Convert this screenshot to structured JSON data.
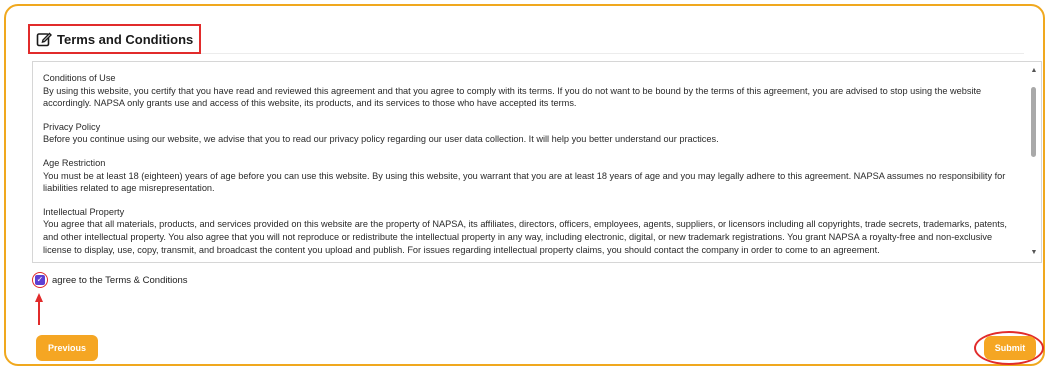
{
  "header": {
    "title": "Terms and Conditions",
    "icon": "edit-square-icon",
    "highlight_color": "#e12b2b"
  },
  "terms": {
    "sections": [
      {
        "title": "Conditions of Use",
        "body": "By using this website, you certify that you have read and reviewed this agreement and that you agree to comply with its terms. If you do not want to be bound by the terms of this agreement, you are advised to stop using the website accordingly. NAPSA only grants use and access of this website, its products, and its services to those who have accepted its terms."
      },
      {
        "title": "Privacy Policy",
        "body": "Before you continue using our website, we advise that you to read our privacy policy regarding our user data collection. It will help you better understand our practices."
      },
      {
        "title": "Age Restriction",
        "body": "You must be at least 18 (eighteen) years of age before you can use this website. By using this website, you warrant that you are at least 18 years of age and you may legally adhere to this agreement. NAPSA assumes no responsibility for liabilities related to age misrepresentation."
      },
      {
        "title": "Intellectual Property",
        "body": "You agree that all materials, products, and services provided on this website are the property of NAPSA, its affiliates, directors, officers, employees, agents, suppliers, or licensors including all copyrights, trade secrets, trademarks, patents, and other intellectual property. You also agree that you will not reproduce or redistribute the intellectual property in any way, including electronic, digital, or new trademark registrations. You grant NAPSA a royalty-free and non-exclusive license to display, use, copy, transmit, and broadcast the content you upload and publish. For issues regarding intellectual property claims, you should contact the company in order to come to an agreement."
      }
    ]
  },
  "agreement": {
    "label": "agree to the Terms & Conditions",
    "checked": true,
    "check_glyph": "✓"
  },
  "buttons": {
    "previous": "Previous",
    "submit": "Submit"
  },
  "colors": {
    "accent": "#f5a623",
    "frame": "#f0a81e",
    "checkbox": "#5d3fd3",
    "annotation": "#e12b2b"
  }
}
